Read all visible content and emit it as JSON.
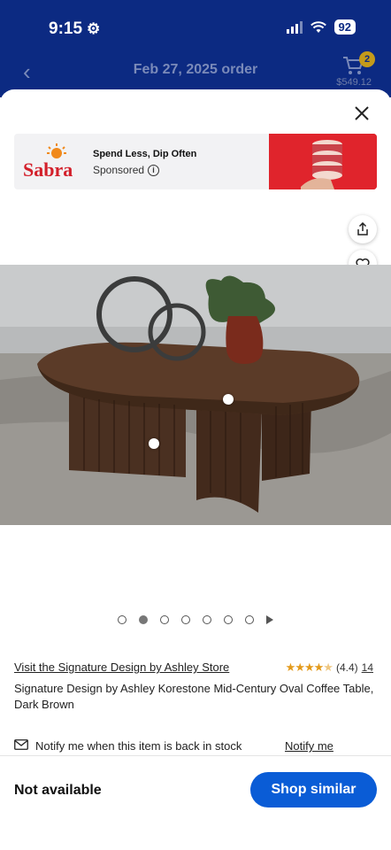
{
  "status_bar": {
    "time": "9:15",
    "battery": "92"
  },
  "nav": {
    "title": "Feb 27, 2025 order",
    "cart_count": "2",
    "cart_total": "$549.12"
  },
  "ad": {
    "brand": "Sabra",
    "headline": "Spend Less, Dip Often",
    "sponsored": "Sponsored",
    "info": "i"
  },
  "carousel": {
    "slide_count": 7,
    "active_index": 1
  },
  "product": {
    "store_link": "Visit the Signature Design by Ashley Store",
    "rating_value": "(4.4)",
    "rating_stars": 4.4,
    "review_count": "14",
    "title": "Signature Design by Ashley Korestone Mid-Century Oval Coffee Table, Dark Brown"
  },
  "notify": {
    "text": "Notify me when this item is back in stock",
    "link": "Notify me"
  },
  "bottom": {
    "status": "Not available",
    "button": "Shop similar"
  },
  "colors": {
    "header_bg": "#0c2a82",
    "primary_button": "#0a5cd6",
    "star": "#e39a1b",
    "ad_accent": "#e0242c"
  }
}
